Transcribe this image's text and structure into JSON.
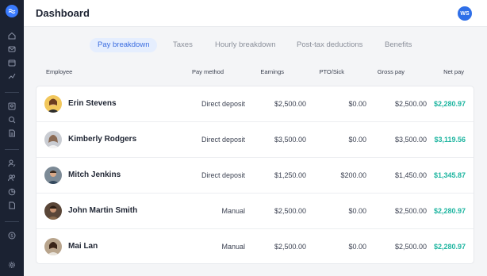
{
  "header": {
    "title": "Dashboard",
    "user_initials": "WS"
  },
  "tabs": [
    {
      "label": "Pay breakdown",
      "active": true
    },
    {
      "label": "Taxes",
      "active": false
    },
    {
      "label": "Hourly breakdown",
      "active": false
    },
    {
      "label": "Post-tax deductions",
      "active": false
    },
    {
      "label": "Benefits",
      "active": false
    }
  ],
  "table": {
    "columns": [
      "Employee",
      "Pay method",
      "Earnings",
      "PTO/Sick",
      "Gross pay",
      "Net pay"
    ],
    "rows": [
      {
        "name": "Erin Stevens",
        "method": "Direct deposit",
        "earnings": "$2,500.00",
        "pto": "$0.00",
        "gross": "$2,500.00",
        "net": "$2,280.97"
      },
      {
        "name": "Kimberly Rodgers",
        "method": "Direct deposit",
        "earnings": "$3,500.00",
        "pto": "$0.00",
        "gross": "$3,500.00",
        "net": "$3,119.56"
      },
      {
        "name": "Mitch Jenkins",
        "method": "Direct deposit",
        "earnings": "$1,250.00",
        "pto": "$200.00",
        "gross": "$1,450.00",
        "net": "$1,345.87"
      },
      {
        "name": "John Martin Smith",
        "method": "Manual",
        "earnings": "$2,500.00",
        "pto": "$0.00",
        "gross": "$2,500.00",
        "net": "$2,280.97"
      },
      {
        "name": "Mai Lan",
        "method": "Manual",
        "earnings": "$2,500.00",
        "pto": "$0.00",
        "gross": "$2,500.00",
        "net": "$2,280.97"
      }
    ]
  },
  "sidebar": {
    "icons": [
      "home-icon",
      "mail-icon",
      "calendar-icon",
      "chart-icon",
      "contact-icon",
      "search-user-icon",
      "document-icon",
      "person-edit-icon",
      "team-icon",
      "pie-chart-icon",
      "file-icon",
      "dollar-icon",
      "settings-icon"
    ]
  },
  "colors": {
    "accent": "#3b6de0",
    "net_pay": "#1eb5a0",
    "sidebar": "#1b2232"
  }
}
